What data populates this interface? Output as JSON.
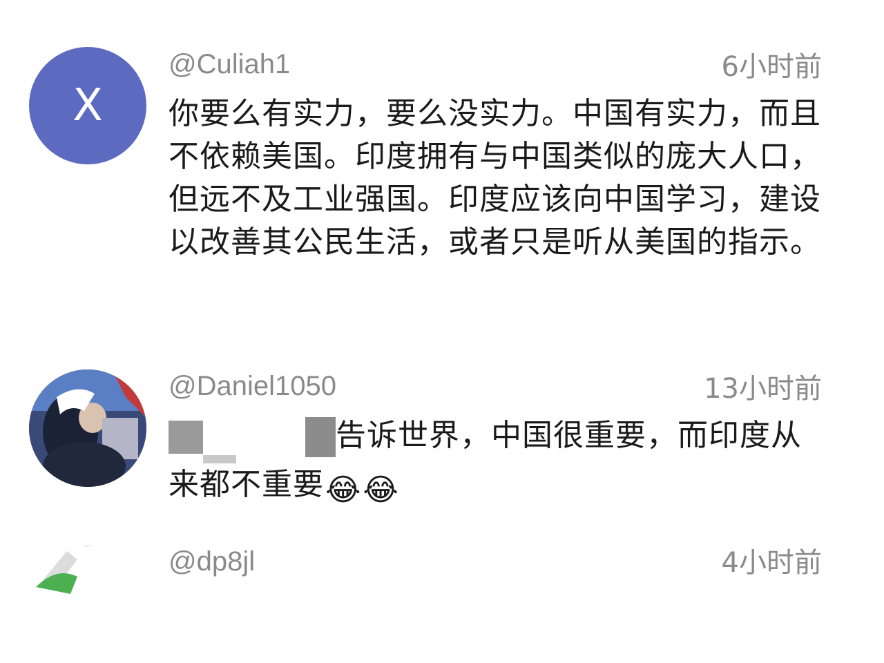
{
  "comments": [
    {
      "avatar_letter": "X",
      "avatar_color": "#5c6bc0",
      "username": "@Culiah1",
      "time": "6小时前",
      "text": "你要么有实力，要么没实力。中国有实力，而且不依赖美国。印度拥有与中国类似的庞大人口，但远不及工业强国。印度应该向中国学习，建设以改善其公民生活，或者只是听从美国的指示。"
    },
    {
      "avatar_icon": "photo-avatar-icon",
      "username": "@Daniel1050",
      "time": "13小时前",
      "text_after_redaction": "告诉世界，中国很重要，而印度从来都不重要",
      "emoji": [
        "😂",
        "😂"
      ]
    },
    {
      "avatar_icon": "partial-avatar-icon",
      "username": "@dp8jl",
      "time": "4小时前"
    }
  ]
}
